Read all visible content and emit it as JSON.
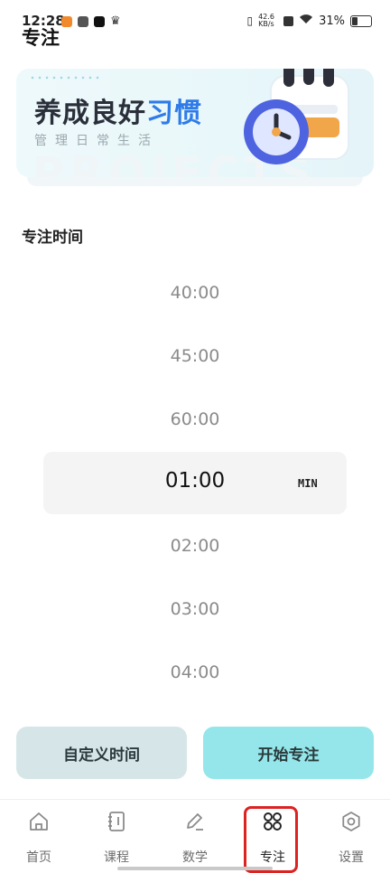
{
  "status_bar": {
    "time": "12:28",
    "net_speed": "42.6 KB/s",
    "battery": "31%"
  },
  "page_title": "专注",
  "banner": {
    "title_part1": "养成良好",
    "title_part2": "习惯",
    "subtitle": "管理日常生活",
    "watermark": "PROJECTS"
  },
  "section_title": "专注时间",
  "picker": {
    "above": [
      "40:00",
      "45:00",
      "60:00"
    ],
    "selected": "01:00",
    "unit": "MIN",
    "below": [
      "02:00",
      "03:00",
      "04:00"
    ]
  },
  "buttons": {
    "custom_time": "自定义时间",
    "start_focus": "开始专注"
  },
  "tabs": [
    {
      "label": "首页",
      "icon": "home-icon"
    },
    {
      "label": "课程",
      "icon": "notebook-icon"
    },
    {
      "label": "数学",
      "icon": "pencil-icon"
    },
    {
      "label": "专注",
      "icon": "grid-icon",
      "active": true
    },
    {
      "label": "设置",
      "icon": "settings-icon"
    }
  ],
  "colors": {
    "accent": "#2f7be8",
    "start_button": "#94e6ea",
    "custom_button": "#d6e6e8",
    "highlight_border": "#dd2222"
  }
}
